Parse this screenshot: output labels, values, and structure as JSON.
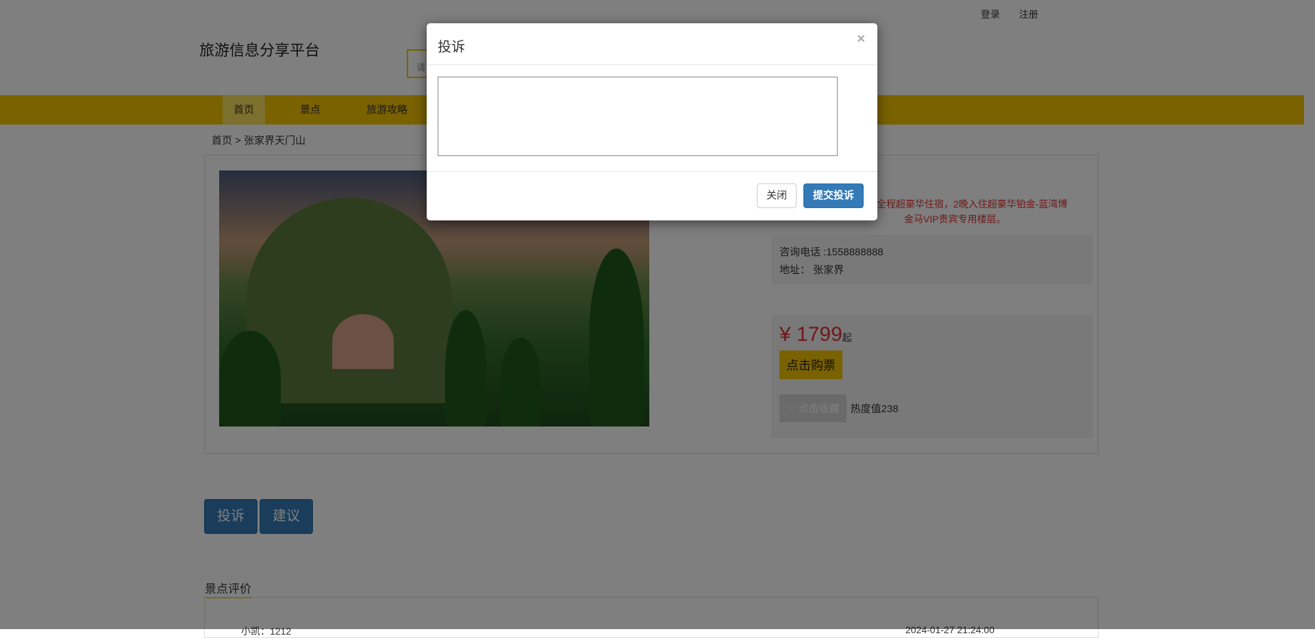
{
  "top_links": {
    "login": "登录",
    "register": "注册"
  },
  "site_title": "旅游信息分享平台",
  "search": {
    "placeholder": "请"
  },
  "nav": {
    "items": [
      "首页",
      "景点",
      "旅游攻略"
    ]
  },
  "breadcrumb": "首页 > 张家界天门山",
  "detail": {
    "description_line1": "全程超豪华住宿，2晚入住超豪华铂金-蓝湾博",
    "description_line2": "金马VIP贵宾专用楼层。",
    "phone": "咨询电话 :1558888888",
    "address": "地址：  张家界",
    "price": "¥ 1799",
    "price_suffix": "起",
    "buy_label": "点击购票",
    "favorite_label": "点击收藏",
    "heat": "热度值238"
  },
  "actions": {
    "complain": "投诉",
    "suggest": "建议"
  },
  "reviews": {
    "title": "景点评价",
    "first_user": "小凯：1212",
    "first_date": "2024-01-27 21:24:00"
  },
  "modal": {
    "title": "投诉",
    "close_glyph": "×",
    "textarea_value": "",
    "close_button": "关闭",
    "submit_button": "提交投诉"
  },
  "colors": {
    "brand": "#f4c400",
    "primary": "#337ab7",
    "price": "#e0313a"
  }
}
